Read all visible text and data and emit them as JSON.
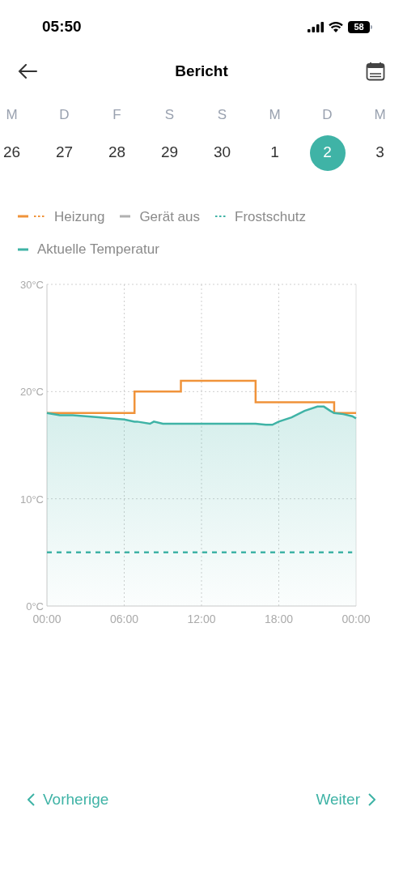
{
  "status_bar": {
    "time": "05:50",
    "battery": "58"
  },
  "header": {
    "title": "Bericht"
  },
  "days": [
    {
      "weekday": "M",
      "date": "26",
      "selected": false
    },
    {
      "weekday": "D",
      "date": "27",
      "selected": false
    },
    {
      "weekday": "F",
      "date": "28",
      "selected": false
    },
    {
      "weekday": "S",
      "date": "29",
      "selected": false
    },
    {
      "weekday": "S",
      "date": "30",
      "selected": false
    },
    {
      "weekday": "M",
      "date": "1",
      "selected": false
    },
    {
      "weekday": "D",
      "date": "2",
      "selected": true
    },
    {
      "weekday": "M",
      "date": "3",
      "selected": false
    }
  ],
  "legend": [
    {
      "kind": "solid_dotted"
    },
    {
      "label": "Gerät aus",
      "kind": "solid",
      "color": "#b0b0b0"
    },
    {
      "kind": "dotted"
    },
    {
      "kind": "solid"
    }
  ],
  "chart": {
    "chart_data": {
      "type": "line",
      "grid": true,
      "x": [
        0,
        1,
        2,
        3,
        4,
        5,
        6,
        6.8,
        6.8,
        7,
        8,
        8.3,
        9,
        10,
        10.4,
        10.4,
        11,
        12,
        13,
        14,
        15,
        16,
        16.2,
        16.2,
        17,
        17.5,
        18,
        19,
        20,
        21,
        21.5,
        22,
        22.3,
        22.3,
        23,
        23.7,
        24
      ],
      "xlim": [
        0,
        24
      ],
      "ylim": [
        0,
        30
      ],
      "xticks": [
        {
          "value": 0,
          "label": "00:00"
        },
        {
          "value": 6,
          "label": "06:00"
        },
        {
          "value": 12,
          "label": "12:00"
        },
        {
          "value": 18,
          "label": "18:00"
        },
        {
          "value": 24,
          "label": "00:00"
        }
      ],
      "yticks": [
        {
          "value": 0,
          "label": "0°C"
        },
        {
          "value": 10,
          "label": "10°C"
        },
        {
          "value": 20,
          "label": "20°C"
        },
        {
          "value": 30,
          "label": "30°C"
        }
      ],
      "series": [
        {
          "name": "Heizung",
          "color": "#f0933a",
          "line_style": "solid",
          "values": [
            18,
            18,
            18,
            18,
            18,
            18,
            18,
            18,
            20,
            20,
            20,
            20,
            20,
            20,
            20,
            21,
            21,
            21,
            21,
            21,
            21,
            21,
            21,
            19,
            19,
            19,
            19,
            19,
            19,
            19,
            19,
            19,
            19,
            18,
            18,
            18,
            18
          ]
        },
        {
          "name": "Frostschutz",
          "color": "#3fb3a6",
          "line_style": "dashed",
          "values": [
            5,
            5,
            5,
            5,
            5,
            5,
            5,
            5,
            5,
            5,
            5,
            5,
            5,
            5,
            5,
            5,
            5,
            5,
            5,
            5,
            5,
            5,
            5,
            5,
            5,
            5,
            5,
            5,
            5,
            5,
            5,
            5,
            5,
            5,
            5,
            5,
            null
          ]
        },
        {
          "name": "Aktuelle Temperatur",
          "color": "#3fb3a6",
          "type": "area",
          "line_style": "solid",
          "values": [
            18,
            17.8,
            17.8,
            17.7,
            17.6,
            17.5,
            17.4,
            17.2,
            17.2,
            17.2,
            17,
            17.2,
            17,
            17,
            17,
            17,
            17,
            17,
            17,
            17,
            17,
            17,
            17,
            17,
            16.9,
            16.9,
            17.2,
            17.6,
            18.2,
            18.6,
            18.6,
            18.2,
            18,
            18,
            17.9,
            17.7,
            17.5
          ]
        }
      ]
    }
  },
  "nav": {
    "previous": "Vorherige",
    "next": "Weiter"
  }
}
